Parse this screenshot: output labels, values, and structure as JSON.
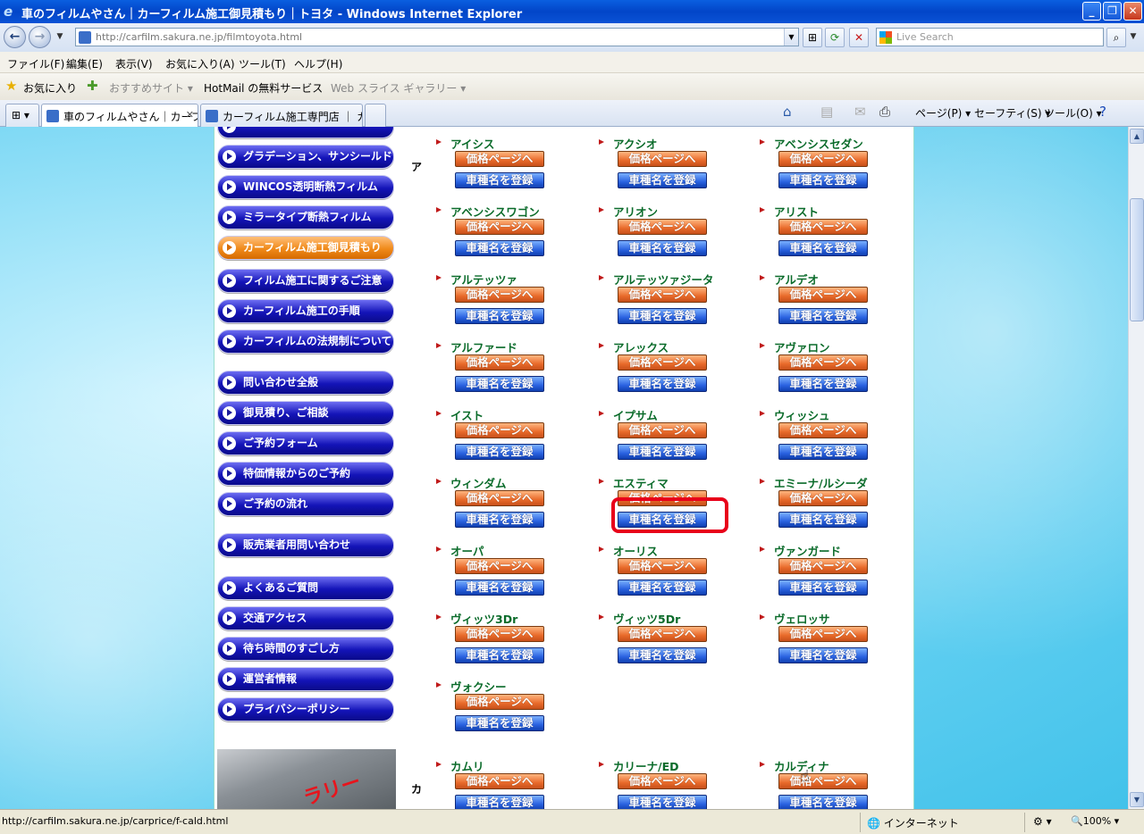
{
  "window": {
    "title": "車のフィルムやさん｜カーフィルム施工御見積もり｜トヨタ - Windows Internet Explorer"
  },
  "address": {
    "url": "http://carfilm.sakura.ne.jp/filmtoyota.html",
    "search_placeholder": "Live Search"
  },
  "menu": [
    "ファイル(F)",
    "編集(E)",
    "表示(V)",
    "お気に入り(A)",
    "ツール(T)",
    "ヘルプ(H)"
  ],
  "favorites": {
    "label": "お気に入り",
    "items": [
      "おすすめサイト ▾",
      "HotMail の無料サービス",
      "Web スライス ギャラリー ▾"
    ]
  },
  "tabs": [
    {
      "label": "車のフィルムやさん｜カーフ..."
    },
    {
      "label": "カーフィルム施工専門店 ｜ ガ..."
    }
  ],
  "commands": [
    "ページ(P) ▾",
    "セーフティ(S) ▾",
    "ツール(O) ▾"
  ],
  "sidebar": {
    "items": [
      {
        "label": "グラデーション、サンシールド",
        "style": "blue"
      },
      {
        "label": "WINCOS透明断熱フィルム",
        "style": "blue"
      },
      {
        "label": "ミラータイプ断熱フィルム",
        "style": "blue"
      },
      {
        "label": "カーフィルム施工御見積もり",
        "style": "orange"
      },
      {
        "label": "フィルム施工に関するご注意",
        "style": "blue"
      },
      {
        "label": "カーフィルム施工の手順",
        "style": "blue"
      },
      {
        "label": "カーフィルムの法規制について",
        "style": "blue"
      },
      {
        "label": "問い合わせ全般",
        "style": "blue"
      },
      {
        "label": "御見積り、ご相談",
        "style": "blue"
      },
      {
        "label": "ご予約フォーム",
        "style": "blue"
      },
      {
        "label": "特価情報からのご予約",
        "style": "blue"
      },
      {
        "label": "ご予約の流れ",
        "style": "blue"
      },
      {
        "label": "販売業者用問い合わせ",
        "style": "blue"
      },
      {
        "label": "よくあるご質問",
        "style": "blue"
      },
      {
        "label": "交通アクセス",
        "style": "blue"
      },
      {
        "label": "待ち時間のすごし方",
        "style": "blue"
      },
      {
        "label": "運営者情報",
        "style": "blue"
      },
      {
        "label": "プライバシーポリシー",
        "style": "blue"
      }
    ],
    "photo_text": "ラリー"
  },
  "buttons": {
    "price": "価格ページへ",
    "register": "車種名を登録"
  },
  "sections": [
    {
      "kana": "ア",
      "cars": [
        "アイシス",
        "アクシオ",
        "アベンシスセダン",
        "アベンシスワゴン",
        "アリオン",
        "アリスト",
        "アルテッツァ",
        "アルテッツァジータ",
        "アルデオ",
        "アルファード",
        "アレックス",
        "アヴァロン",
        "イスト",
        "イプサム",
        "ウィッシュ",
        "ウィンダム",
        "エスティマ",
        "エミーナ/ルシーダ",
        "オーパ",
        "オーリス",
        "ヴァンガード",
        "ヴィッツ3Dr",
        "ヴィッツ5Dr",
        "ヴェロッサ",
        "ヴォクシー"
      ]
    },
    {
      "kana": "カ",
      "cars": [
        "カムリ",
        "カリーナ/ED",
        "カルディナ"
      ]
    }
  ],
  "status": {
    "url": "http://carfilm.sakura.ne.jp/carprice/f-cald.html",
    "zone": "インターネット",
    "zoom": "100%"
  }
}
